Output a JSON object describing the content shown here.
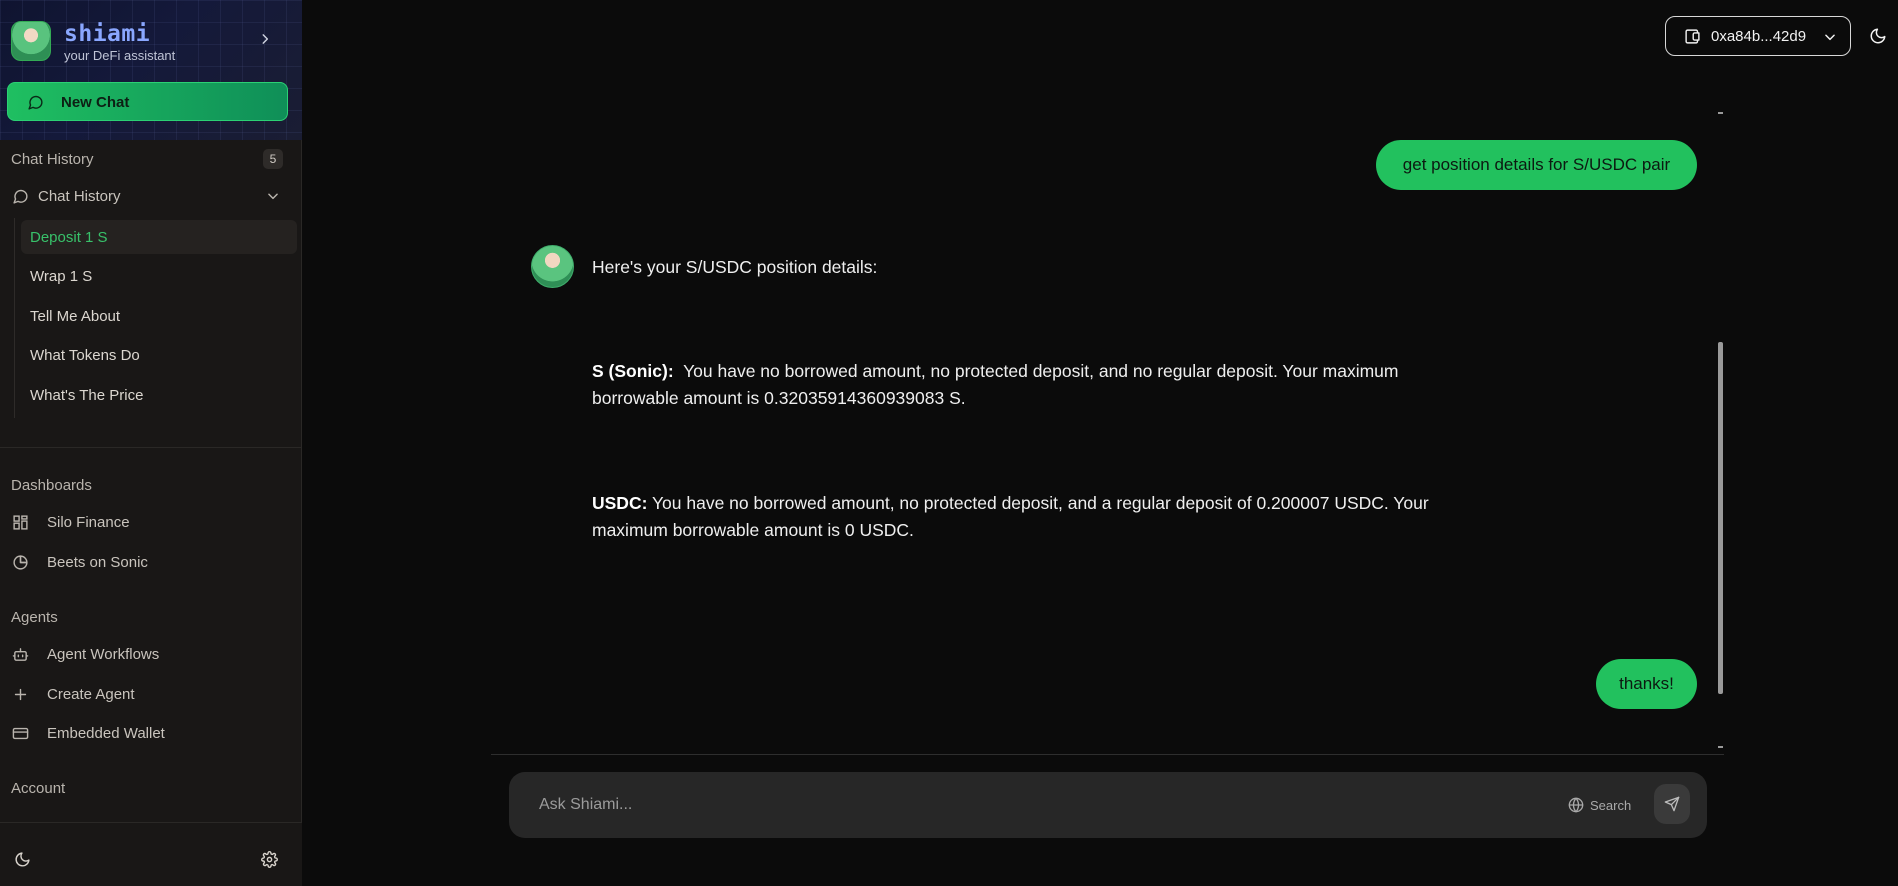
{
  "brand": {
    "name": "shiami",
    "subtitle": "your DeFi assistant"
  },
  "sidebar": {
    "new_chat_label": "New Chat",
    "history_section": {
      "title": "Chat History",
      "count": "5",
      "group_label": "Chat History"
    },
    "history_items": [
      {
        "label": "Deposit 1 S",
        "active": true
      },
      {
        "label": "Wrap 1 S",
        "active": false
      },
      {
        "label": "Tell Me About",
        "active": false
      },
      {
        "label": "What Tokens Do",
        "active": false
      },
      {
        "label": "What's The Price",
        "active": false
      }
    ],
    "dashboards": {
      "title": "Dashboards",
      "items": [
        {
          "label": "Silo Finance",
          "icon": "grid-icon"
        },
        {
          "label": "Beets on Sonic",
          "icon": "pie-chart-icon"
        }
      ]
    },
    "agents": {
      "title": "Agents",
      "items": [
        {
          "label": "Agent Workflows",
          "icon": "bot-icon"
        },
        {
          "label": "Create Agent",
          "icon": "plus-icon"
        },
        {
          "label": "Embedded Wallet",
          "icon": "card-icon"
        }
      ]
    },
    "account": {
      "title": "Account"
    }
  },
  "header": {
    "wallet_label": "0xa84b...42d9"
  },
  "chat": {
    "messages": [
      {
        "role": "user",
        "text": "get position details for S/USDC pair"
      },
      {
        "role": "assistant",
        "intro": "Here's your S/USDC position details:",
        "items": [
          {
            "label": "S (Sonic):",
            "text": "You have no borrowed amount, no protected deposit, and no regular deposit. Your maximum",
            "text2": "borrowable amount is 0.32035914360939083 S."
          },
          {
            "label": "USDC:",
            "text": "You have no borrowed amount, no protected deposit, and a regular deposit of 0.200007 USDC. Your",
            "text2": "maximum borrowable amount is 0 USDC."
          }
        ]
      },
      {
        "role": "user",
        "text": "thanks!"
      }
    ]
  },
  "composer": {
    "placeholder": "Ask Shiami...",
    "search_label": "Search"
  },
  "colors": {
    "accent": "#22c15e",
    "background": "#0b0b0b",
    "sidebar": "#191716",
    "brand": "#8aa7ff"
  }
}
